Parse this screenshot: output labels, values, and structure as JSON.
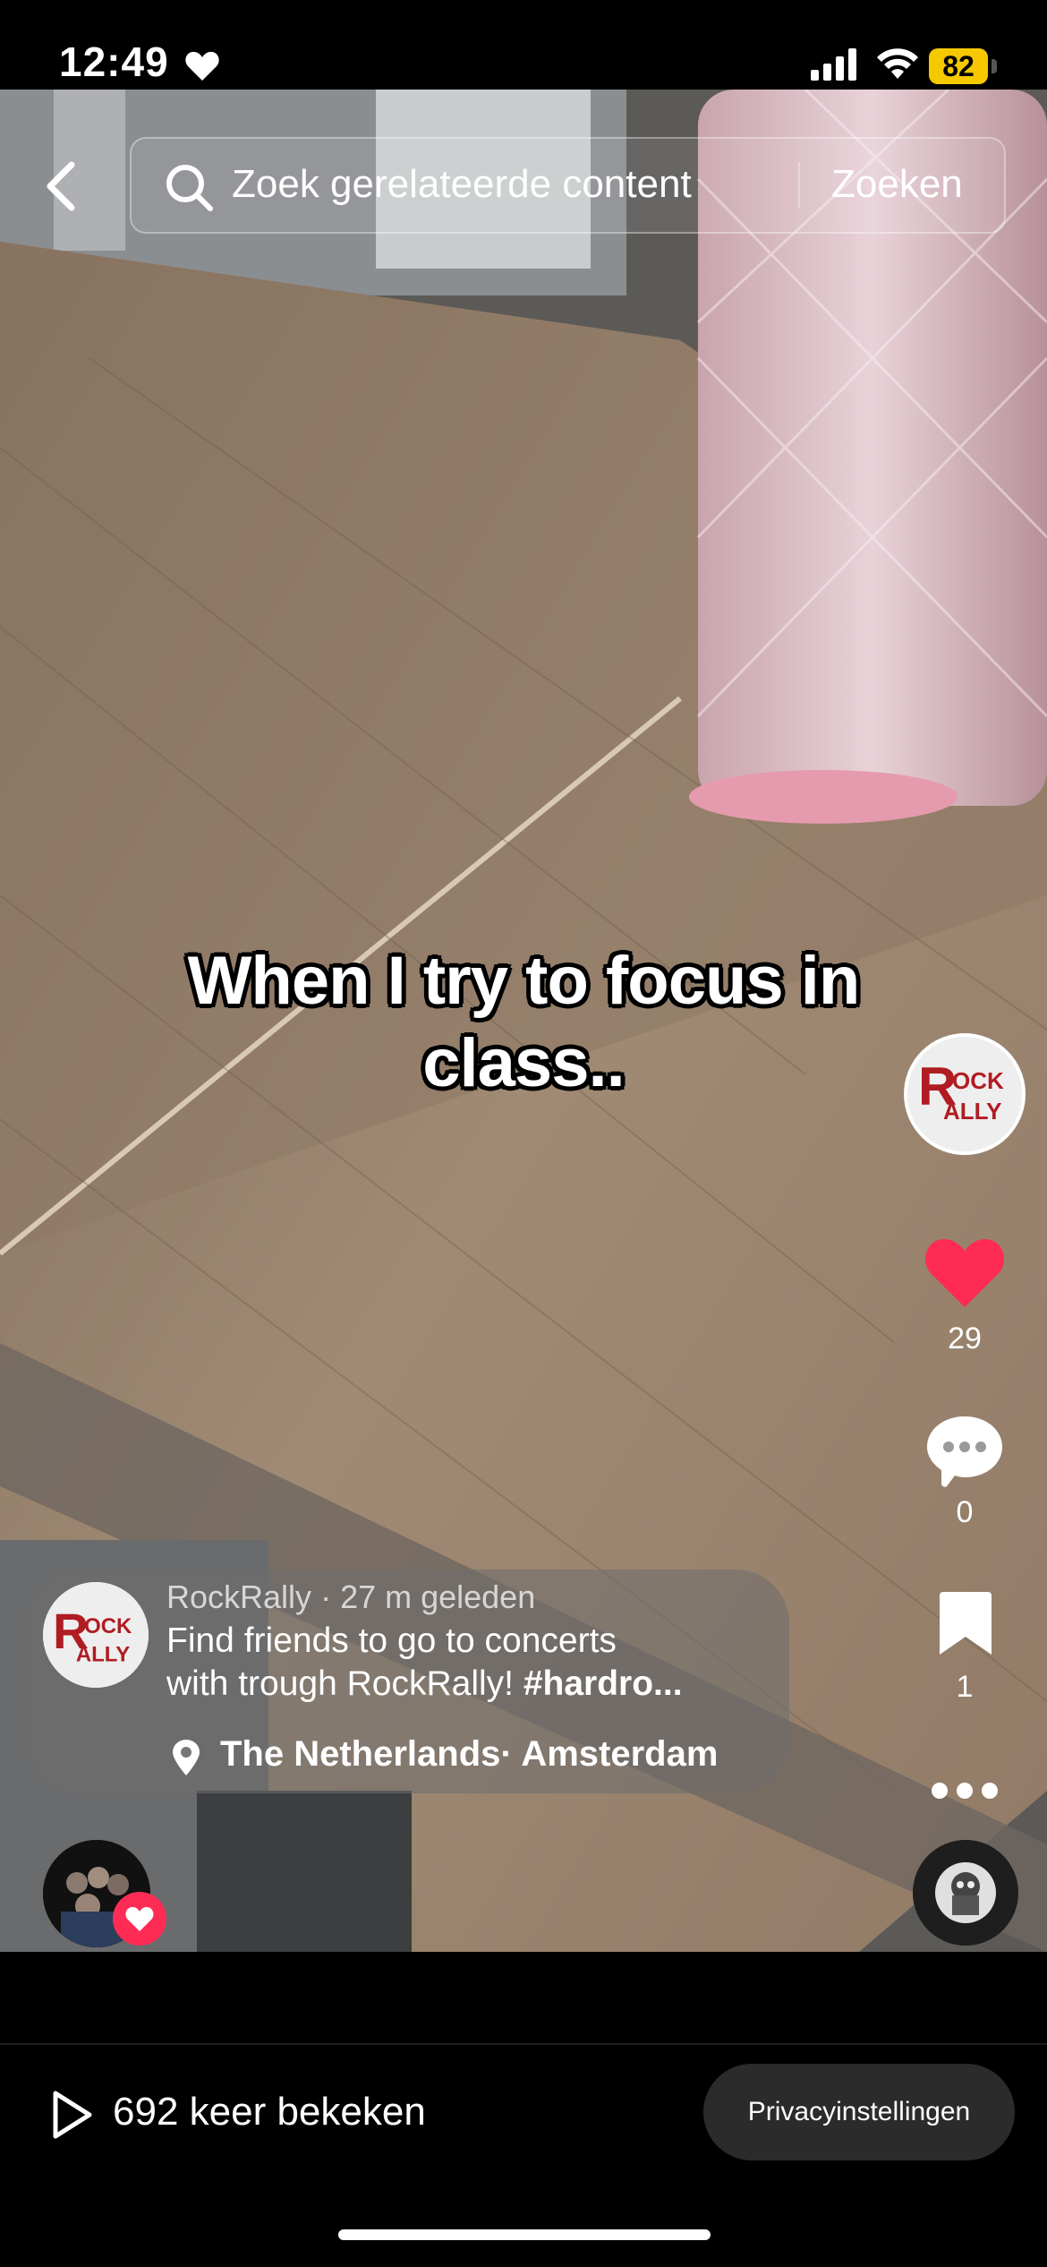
{
  "status_bar": {
    "time": "12:49",
    "battery": "82"
  },
  "search": {
    "placeholder": "Zoek gerelateerde content",
    "button": "Zoeken"
  },
  "video": {
    "caption_line1": "When I try to focus in",
    "caption_line2": "class.."
  },
  "rail": {
    "avatar_brand": "ROCK RALLY",
    "likes": "29",
    "comments": "0",
    "saves": "1"
  },
  "post": {
    "author": "RockRally",
    "age": "27 m geleden",
    "desc_line1": "Find friends to go to concerts",
    "desc_line2": "with trough RockRally!",
    "hashtag": "#hardro...",
    "location": "The Netherlands· Amsterdam"
  },
  "bottom": {
    "views": "692 keer bekeken",
    "privacy": "Privacyinstellingen"
  },
  "colors": {
    "like": "#fe2c55",
    "battery": "#f5c800"
  }
}
